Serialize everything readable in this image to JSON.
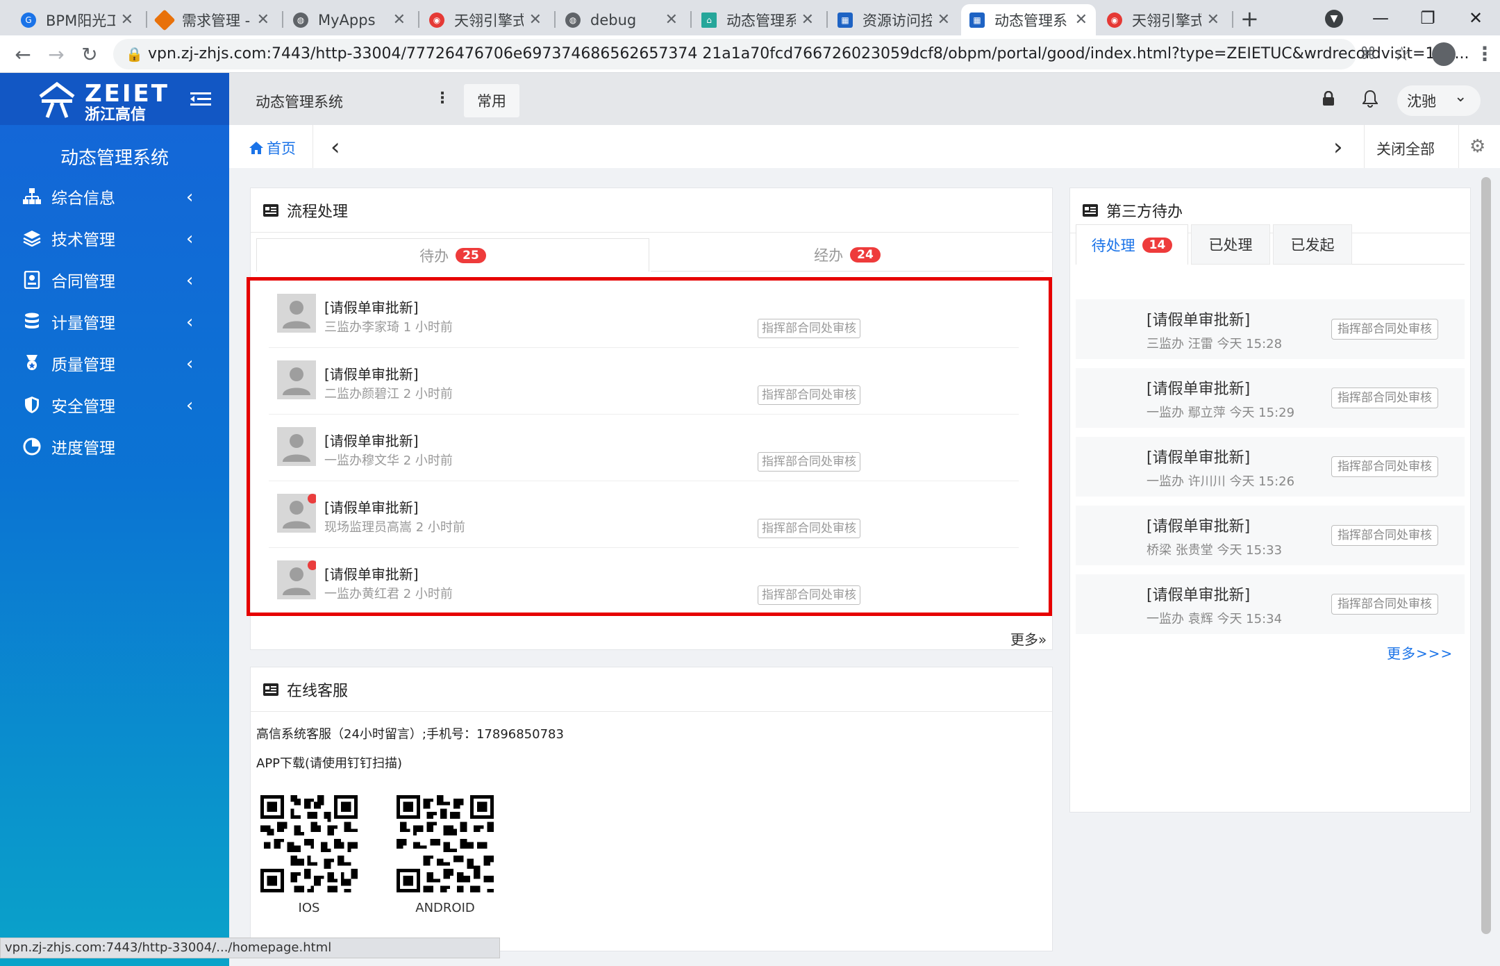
{
  "browser": {
    "tabs": [
      {
        "title": "BPM阳光工…",
        "color": "#1a73e8"
      },
      {
        "title": "需求管理 - ",
        "color": "#e8710a"
      },
      {
        "title": "MyApps",
        "color": "#5f6368"
      },
      {
        "title": "天翎引擎式",
        "color": "#e53935"
      },
      {
        "title": "debug",
        "color": "#5f6368"
      },
      {
        "title": "动态管理系",
        "color": "#26a69a"
      },
      {
        "title": "资源访问控",
        "color": "#1e63c4"
      },
      {
        "title": "动态管理系",
        "color": "#1e63c4"
      },
      {
        "title": "天翎引擎式",
        "color": "#e53935"
      }
    ],
    "url": "vpn.zj-zhjs.com:7443/http-33004/77726476706e697374686562657374 21a1a70fcd766726023059dcf8/obpm/portal/good/index.html?type=ZEIETUC&wrdrecordvisit=160...",
    "status_url": "vpn.zj-zhjs.com:7443/http-33004/.../homepage.html"
  },
  "sidebar": {
    "logo_line1": "ZEIET",
    "logo_line2": "浙江高信",
    "system_title": "动态管理系统",
    "items": [
      {
        "label": "综合信息",
        "icon": "sitemap-icon"
      },
      {
        "label": "技术管理",
        "icon": "stack-icon"
      },
      {
        "label": "合同管理",
        "icon": "contract-icon"
      },
      {
        "label": "计量管理",
        "icon": "database-icon"
      },
      {
        "label": "质量管理",
        "icon": "award-icon"
      },
      {
        "label": "安全管理",
        "icon": "shield-icon"
      },
      {
        "label": "进度管理",
        "icon": "pie-icon"
      }
    ]
  },
  "header": {
    "title": "动态管理系统",
    "common_label": "常用",
    "user_name": "沈驰"
  },
  "tabnav": {
    "home_label": "首页",
    "close_all_label": "关闭全部"
  },
  "flow": {
    "title": "流程处理",
    "tab_todo": "待办",
    "tab_todo_count": "25",
    "tab_done": "经办",
    "tab_done_count": "24",
    "items": [
      {
        "title": "[请假单审批新]",
        "sub": "三监办李家琦 1 小时前",
        "tag": "指挥部合同处审核",
        "unread": false
      },
      {
        "title": "[请假单审批新]",
        "sub": "二监办颜碧江 2 小时前",
        "tag": "指挥部合同处审核",
        "unread": false
      },
      {
        "title": "[请假单审批新]",
        "sub": "一监办穆文华 2 小时前",
        "tag": "指挥部合同处审核",
        "unread": false
      },
      {
        "title": "[请假单审批新]",
        "sub": "现场监理员高嵩 2 小时前",
        "tag": "指挥部合同处审核",
        "unread": true
      },
      {
        "title": "[请假单审批新]",
        "sub": "一监办黄红君 2 小时前",
        "tag": "指挥部合同处审核",
        "unread": true
      }
    ],
    "more_label": "更多»"
  },
  "third_party": {
    "title": "第三方待办",
    "tab_pending": "待处理",
    "tab_pending_count": "14",
    "tab_processed": "已处理",
    "tab_initiated": "已发起",
    "items": [
      {
        "title": "[请假单审批新]",
        "sub": "三监办 汪雷 今天 15:28",
        "tag": "指挥部合同处审核"
      },
      {
        "title": "[请假单审批新]",
        "sub": "一监办 鄢立萍 今天 15:29",
        "tag": "指挥部合同处审核"
      },
      {
        "title": "[请假单审批新]",
        "sub": "一监办 许川川 今天 15:26",
        "tag": "指挥部合同处审核"
      },
      {
        "title": "[请假单审批新]",
        "sub": "桥梁 张贵堂 今天 15:33",
        "tag": "指挥部合同处审核"
      },
      {
        "title": "[请假单审批新]",
        "sub": "一监办 袁辉 今天 15:34",
        "tag": "指挥部合同处审核"
      }
    ],
    "more_label": "更多>>>"
  },
  "service": {
    "title": "在线客服",
    "line1": "高信系统客服（24小时留言）;手机号：17896850783",
    "line2": "APP下载(请使用钉钉扫描)",
    "qr_ios_label": "IOS",
    "qr_android_label": "ANDROID"
  },
  "colors": {
    "highlight_border": "#e60000",
    "badge": "#ee3b3b",
    "accent": "#1a73e8"
  }
}
